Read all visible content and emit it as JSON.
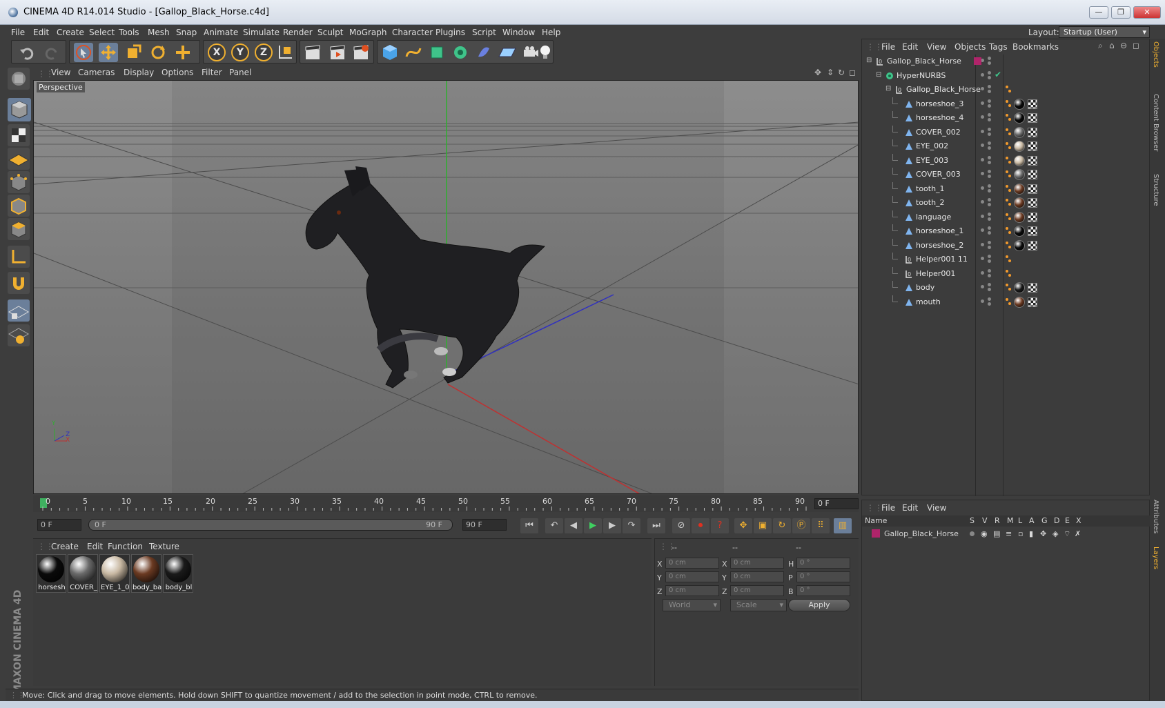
{
  "window": {
    "title": "CINEMA 4D R14.014 Studio - [Gallop_Black_Horse.c4d]",
    "controls": {
      "minimize": "—",
      "maximize": "❐",
      "close": "✕"
    }
  },
  "menubar": {
    "items": [
      "File",
      "Edit",
      "Create",
      "Select",
      "Tools",
      "Mesh",
      "Snap",
      "Animate",
      "Simulate",
      "Render",
      "Sculpt",
      "MoGraph",
      "Character",
      "Plugins",
      "Script",
      "Window",
      "Help"
    ],
    "layout_label": "Layout:",
    "layout_value": "Startup (User)"
  },
  "toolbar": {
    "axis_x": "X",
    "axis_y": "Y",
    "axis_z": "Z"
  },
  "viewport": {
    "menu": [
      "View",
      "Cameras",
      "Display",
      "Options",
      "Filter",
      "Panel"
    ],
    "label": "Perspective",
    "axis_y": "Y",
    "axis_z": "Z",
    "axis_x": "X"
  },
  "timeline": {
    "ticks": [
      "0",
      "5",
      "10",
      "15",
      "20",
      "25",
      "30",
      "35",
      "40",
      "45",
      "50",
      "55",
      "60",
      "65",
      "70",
      "75",
      "80",
      "85",
      "90"
    ],
    "current_frame": "0 F"
  },
  "transport": {
    "start_field": "0 F",
    "range_start": "0 F",
    "range_end": "90 F",
    "end_field": "90 F"
  },
  "materials": {
    "menu": [
      "Create",
      "Edit",
      "Function",
      "Texture"
    ],
    "items": [
      {
        "label": "horsesh",
        "color": "#0a0a0a"
      },
      {
        "label": "COVER_",
        "color": "#6a6a6a"
      },
      {
        "label": "EYE_1_0(",
        "color": "#c9b9a3"
      },
      {
        "label": "body_ba",
        "color": "#6b3a22"
      },
      {
        "label": "body_bl",
        "color": "#1a1a1a"
      }
    ]
  },
  "coords": {
    "header": [
      "--",
      "--",
      "--"
    ],
    "rows": [
      {
        "l1": "X",
        "v1": "0 cm",
        "l2": "X",
        "v2": "0 cm",
        "l3": "H",
        "v3": "0 °"
      },
      {
        "l1": "Y",
        "v1": "0 cm",
        "l2": "Y",
        "v2": "0 cm",
        "l3": "P",
        "v3": "0 °"
      },
      {
        "l1": "Z",
        "v1": "0 cm",
        "l2": "Z",
        "v2": "0 cm",
        "l3": "B",
        "v3": "0 °"
      }
    ],
    "mode1": "World",
    "mode2": "Scale",
    "apply": "Apply"
  },
  "status": "Move: Click and drag to move elements. Hold down SHIFT to quantize movement / add to the selection in point mode, CTRL to remove.",
  "objects": {
    "menu": [
      "File",
      "Edit",
      "View",
      "Objects",
      "Tags",
      "Bookmarks"
    ],
    "tree": [
      {
        "name": "Gallop_Black_Horse",
        "indent": 0,
        "type": "null"
      },
      {
        "name": "HyperNURBS",
        "indent": 1,
        "type": "nurbs"
      },
      {
        "name": "Gallop_Black_Horse",
        "indent": 2,
        "type": "null"
      },
      {
        "name": "horseshoe_3",
        "indent": 3,
        "type": "poly",
        "tag": "#0a0a0a"
      },
      {
        "name": "horseshoe_4",
        "indent": 3,
        "type": "poly",
        "tag": "#0a0a0a"
      },
      {
        "name": "COVER_002",
        "indent": 3,
        "type": "poly",
        "tag": "#6a6a6a"
      },
      {
        "name": "EYE_002",
        "indent": 3,
        "type": "poly",
        "tag": "#c9b9a3"
      },
      {
        "name": "EYE_003",
        "indent": 3,
        "type": "poly",
        "tag": "#c9b9a3"
      },
      {
        "name": "COVER_003",
        "indent": 3,
        "type": "poly",
        "tag": "#6a6a6a"
      },
      {
        "name": "tooth_1",
        "indent": 3,
        "type": "poly",
        "tag": "#6b3a22"
      },
      {
        "name": "tooth_2",
        "indent": 3,
        "type": "poly",
        "tag": "#6b3a22"
      },
      {
        "name": "language",
        "indent": 3,
        "type": "poly",
        "tag": "#6b3a22"
      },
      {
        "name": "horseshoe_1",
        "indent": 3,
        "type": "poly",
        "tag": "#0a0a0a"
      },
      {
        "name": "horseshoe_2",
        "indent": 3,
        "type": "poly",
        "tag": "#0a0a0a"
      },
      {
        "name": "Helper001 11",
        "indent": 3,
        "type": "null"
      },
      {
        "name": "Helper001",
        "indent": 3,
        "type": "null"
      },
      {
        "name": "body",
        "indent": 3,
        "type": "poly",
        "tag": "#1a1a1a"
      },
      {
        "name": "mouth",
        "indent": 3,
        "type": "poly",
        "tag": "#6b3a22"
      }
    ]
  },
  "layers": {
    "menu": [
      "File",
      "Edit",
      "View"
    ],
    "columns": [
      "Name",
      "S",
      "V",
      "R",
      "M",
      "L",
      "A",
      "G",
      "D",
      "E",
      "X"
    ],
    "rows": [
      {
        "name": "Gallop_Black_Horse",
        "color": "#b0246a"
      }
    ]
  },
  "right_tabs": [
    "Objects",
    "Content Browser",
    "Structure",
    "Attributes",
    "Layers"
  ],
  "logo": "MAXON CINEMA 4D",
  "colors": {
    "accent": "#f0b030",
    "selection": "#6b7f9a",
    "layer": "#b0246a"
  }
}
